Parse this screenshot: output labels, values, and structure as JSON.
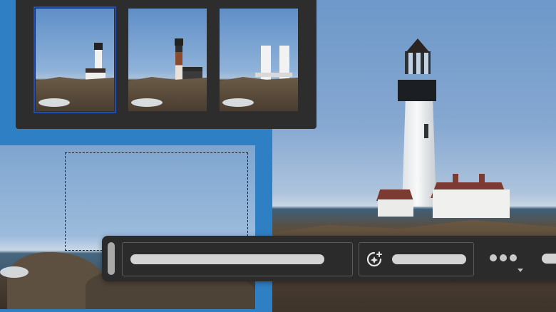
{
  "thumbnails": [
    {
      "name": "variation-1",
      "selected": true
    },
    {
      "name": "variation-2",
      "selected": false
    },
    {
      "name": "variation-3",
      "selected": false
    }
  ],
  "toolbar": {
    "prompt_placeholder": "",
    "generate_icon": "generative-fill-sparkle-icon",
    "more_icon": "more-options-icon",
    "expand_icon": "chevron-down-icon"
  },
  "colors": {
    "accent": "#1f4cb8",
    "toolbar_bg": "#2b2b2c",
    "panel_bg": "#2d2d2e",
    "canvas_bg": "#2f7fc4"
  }
}
